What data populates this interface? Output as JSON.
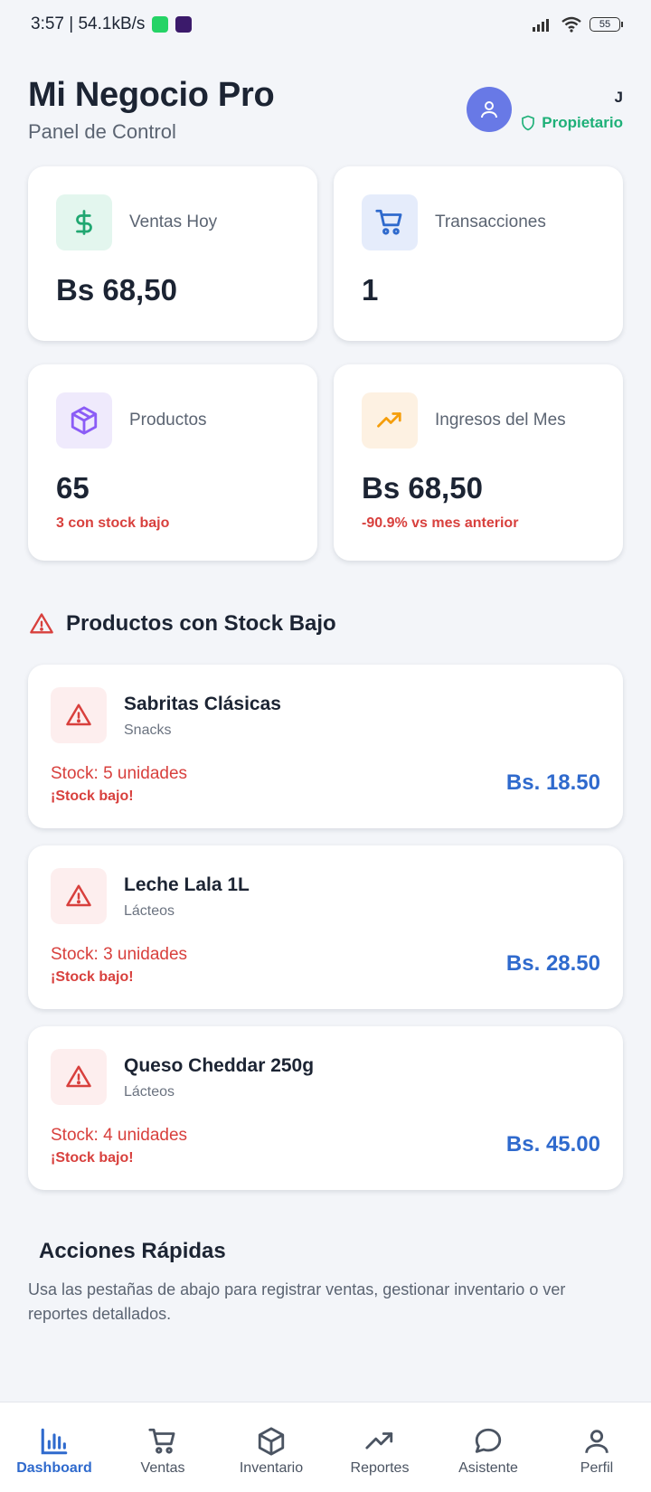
{
  "status_bar": {
    "time_speed": "3:57 | 54.1kB/s",
    "battery": "55"
  },
  "header": {
    "title": "Mi Negocio Pro",
    "subtitle": "Panel de Control",
    "user_initial": "J",
    "role": "Propietario"
  },
  "stats": [
    {
      "label": "Ventas Hoy",
      "value": "Bs 68,50",
      "note": "",
      "icon": "dollar-icon",
      "bg": "#e3f6ee",
      "color": "#20a771"
    },
    {
      "label": "Transacciones",
      "value": "1",
      "note": "",
      "icon": "cart-icon",
      "bg": "#e5ecfb",
      "color": "#2f6acd"
    },
    {
      "label": "Productos",
      "value": "65",
      "note": "3 con stock bajo",
      "icon": "box-icon",
      "bg": "#efeafc",
      "color": "#8b5cf6"
    },
    {
      "label": "Ingresos del Mes",
      "value": "Bs 68,50",
      "note": "-90.9% vs mes anterior",
      "icon": "trending-up-icon",
      "bg": "#fdf1e2",
      "color": "#f59e0b"
    }
  ],
  "low_stock": {
    "title": "Productos con Stock Bajo",
    "items": [
      {
        "name": "Sabritas Clásicas",
        "category": "Snacks",
        "stock": "Stock: 5 unidades",
        "warning": "¡Stock bajo!",
        "price": "Bs. 18.50"
      },
      {
        "name": "Leche Lala 1L",
        "category": "Lácteos",
        "stock": "Stock: 3 unidades",
        "warning": "¡Stock bajo!",
        "price": "Bs. 28.50"
      },
      {
        "name": "Queso Cheddar 250g",
        "category": "Lácteos",
        "stock": "Stock: 4 unidades",
        "warning": "¡Stock bajo!",
        "price": "Bs. 45.00"
      }
    ]
  },
  "quick_actions": {
    "title": "Acciones Rápidas",
    "text": "Usa las pestañas de abajo para registrar ventas, gestionar inventario o ver reportes detallados."
  },
  "nav": [
    {
      "label": "Dashboard",
      "icon": "bar-chart-icon",
      "active": true
    },
    {
      "label": "Ventas",
      "icon": "cart-icon",
      "active": false
    },
    {
      "label": "Inventario",
      "icon": "box-icon",
      "active": false
    },
    {
      "label": "Reportes",
      "icon": "trending-up-icon",
      "active": false
    },
    {
      "label": "Asistente",
      "icon": "chat-bubble-icon",
      "active": false
    },
    {
      "label": "Perfil",
      "icon": "user-icon",
      "active": false
    }
  ],
  "colors": {
    "accent": "#2f6acd",
    "danger": "#d8403d",
    "success": "#1eb078",
    "avatar": "#6879e6"
  }
}
